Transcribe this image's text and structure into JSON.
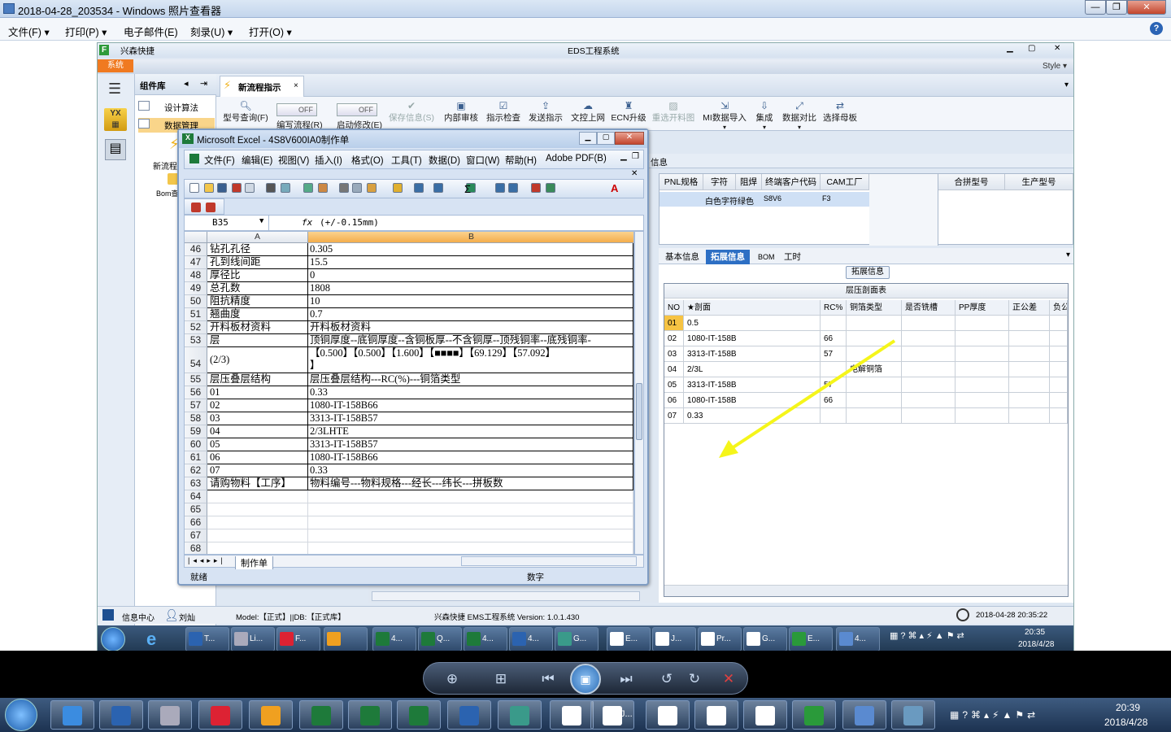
{
  "viewer": {
    "title": "2018-04-28_203534 - Windows 照片查看器",
    "menu": [
      "文件(F)",
      "打印(P)",
      "电子邮件(E)",
      "刻录(U)",
      "打开(O)"
    ],
    "help": "?"
  },
  "eds": {
    "app_short": "兴森快捷",
    "title": "EDS工程系统",
    "style_label": "Style",
    "sys_tab": "系统",
    "nav_header": "组件库",
    "nav_items": [
      "设计算法",
      "数据管理"
    ],
    "nav_side_labels": [
      "新流程",
      "Bom查"
    ],
    "doc_tab": "新流程指示",
    "ribbon": [
      {
        "label": "型号查询(F)",
        "icon": "search-icon"
      },
      {
        "label": "编写流程(R)",
        "icon": "toggle"
      },
      {
        "label": "启动修改(E)",
        "icon": "toggle"
      },
      {
        "label": "保存信息(S)",
        "icon": "check-icon",
        "disabled": true
      },
      {
        "label": "内部审核",
        "icon": "print-icon"
      },
      {
        "label": "指示检查",
        "icon": "checklist-icon"
      },
      {
        "label": "发送指示",
        "icon": "upload-icon"
      },
      {
        "label": "文控上网",
        "icon": "cloud-upload-icon"
      },
      {
        "label": "ECN升级",
        "icon": "ecn-icon"
      },
      {
        "label": "重选开料图",
        "icon": "image-icon",
        "disabled": true
      },
      {
        "label": "MI数据导入",
        "icon": "import-icon"
      },
      {
        "label": "集成",
        "icon": "download-icon"
      },
      {
        "label": "数据对比",
        "icon": "compare-icon"
      },
      {
        "label": "选择母板",
        "icon": "shuffle-icon"
      }
    ],
    "toggle_off": "OFF",
    "info_tab": "信息",
    "grid1_headers": [
      "PNL规格",
      "字符",
      "阻焊",
      "终端客户代码",
      "CAM工厂",
      "合拼型号",
      "生产型号"
    ],
    "grid1_row": [
      "",
      "白色字符",
      "绿色",
      "S8V6",
      "F3"
    ],
    "tabs": [
      "基本信息",
      "拓展信息",
      "BOM",
      "工时"
    ],
    "sub_tab": "拓展信息",
    "layer_title": "层压剖面表",
    "layer_headers": [
      "NO",
      "★剖面",
      "RC%",
      "铜箔类型",
      "是否铣槽",
      "PP厚度",
      "正公差",
      "负公"
    ],
    "layer_rows": [
      [
        "01",
        "0.5",
        "",
        ""
      ],
      [
        "02",
        "1080-IT-158B",
        "66",
        ""
      ],
      [
        "03",
        "3313-IT-158B",
        "57",
        ""
      ],
      [
        "04",
        "2/3L",
        "",
        "电解铜箔"
      ],
      [
        "05",
        "3313-IT-158B",
        "57",
        ""
      ],
      [
        "06",
        "1080-IT-158B",
        "66",
        ""
      ],
      [
        "07",
        "0.33",
        "",
        ""
      ]
    ],
    "status": {
      "info_center": "信息中心",
      "user": "刘灿",
      "model": "Model:【正式】||DB:【正式库】",
      "system": "兴森快捷  EMS工程系统  Version: 1.0.1.430",
      "datetime": "2018-04-28 20:35:22"
    },
    "taskbar": {
      "items": [
        "T...",
        "Li...",
        "F...",
        "",
        "4...",
        "Q...",
        "4...",
        "4...",
        "G...",
        "E...",
        "J...",
        "Pr...",
        "G...",
        "E...",
        "4..."
      ],
      "time": "20:35",
      "date": "2018/4/28"
    }
  },
  "excel": {
    "title": "Microsoft Excel - 4S8V600IA0制作单",
    "menu": [
      "文件(F)",
      "编辑(E)",
      "视图(V)",
      "插入(I)",
      "格式(O)",
      "工具(T)",
      "数据(D)",
      "窗口(W)",
      "帮助(H)",
      "Adobe PDF(B)"
    ],
    "name_box": "B35",
    "fx": "fx",
    "formula": "(+/-0.15mm)",
    "col_a": "A",
    "col_b": "B",
    "rows": [
      {
        "n": "46",
        "a": "钻孔孔径",
        "b": "0.305"
      },
      {
        "n": "47",
        "a": "孔到线间距",
        "b": "15.5"
      },
      {
        "n": "48",
        "a": "厚径比",
        "b": "0"
      },
      {
        "n": "49",
        "a": "总孔数",
        "b": "1808"
      },
      {
        "n": "50",
        "a": "阻抗精度",
        "b": "10"
      },
      {
        "n": "51",
        "a": "翘曲度",
        "b": "0.7"
      },
      {
        "n": "52",
        "a": "开料板材资料",
        "b": "开料板材资料"
      },
      {
        "n": "53",
        "a": "层",
        "b": "顶铜厚度--底铜厚度--含铜板厚--不含铜厚--顶残铜率--底残铜率-"
      },
      {
        "n": "54",
        "a": "(2/3)",
        "b": "【0.500】【0.500】【1.600】【■■■■】【69.129】【57.092】",
        "b2": "】"
      },
      {
        "n": "55",
        "a": "层压叠层结构",
        "b": "层压叠层结构---RC(%)---铜箔类型"
      },
      {
        "n": "56",
        "a": "01",
        "b": "0.33"
      },
      {
        "n": "57",
        "a": "02",
        "b": "1080-IT-158B66"
      },
      {
        "n": "58",
        "a": "03",
        "b": "3313-IT-158B57"
      },
      {
        "n": "59",
        "a": "04",
        "b": "2/3LHTE"
      },
      {
        "n": "60",
        "a": "05",
        "b": "3313-IT-158B57"
      },
      {
        "n": "61",
        "a": "06",
        "b": "1080-IT-158B66"
      },
      {
        "n": "62",
        "a": "07",
        "b": "0.33"
      },
      {
        "n": "63",
        "a": "请购物料【工序】",
        "b": "物料编号---物料规格---经长---纬长---拼板数"
      },
      {
        "n": "64",
        "a": "",
        "b": ""
      },
      {
        "n": "65",
        "a": "",
        "b": ""
      },
      {
        "n": "66",
        "a": "",
        "b": ""
      },
      {
        "n": "67",
        "a": "",
        "b": ""
      },
      {
        "n": "68",
        "a": "",
        "b": ""
      }
    ],
    "sheet_tab": "制作单",
    "status_ready": "就绪",
    "status_num": "数字"
  },
  "bottom_taskbar": {
    "time": "20:39",
    "date": "2018/4/28",
    "items": [
      "",
      "",
      "",
      "",
      "",
      "",
      "",
      "",
      "",
      "",
      "",
      "J...",
      "",
      "",
      "",
      "",
      "",
      ""
    ]
  },
  "colors": {
    "accent": "#2d6fc4",
    "orange": "#f07a21",
    "arrow": "#f5f51a"
  }
}
